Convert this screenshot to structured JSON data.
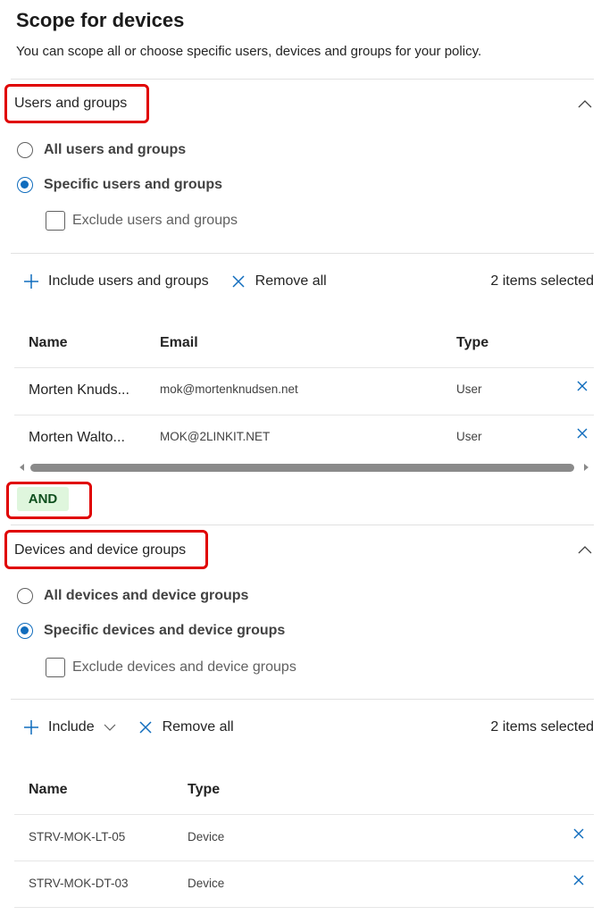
{
  "header": {
    "title": "Scope for devices",
    "subtitle": "You can scope all or choose specific users, devices and groups for your policy."
  },
  "users_section": {
    "title": "Users and groups",
    "option_all": "All users and groups",
    "option_specific": "Specific users and groups",
    "selected_option": "specific",
    "exclude_label": "Exclude users and groups",
    "toolbar": {
      "include_label": "Include users and groups",
      "remove_all_label": "Remove all",
      "count_label": "2 items selected"
    },
    "columns": [
      "Name",
      "Email",
      "Type"
    ],
    "rows": [
      {
        "name": "Morten Knuds...",
        "email": "mok@mortenknudsen.net",
        "type": "User"
      },
      {
        "name": "Morten Walto...",
        "email": "MOK@2LINKIT.NET",
        "type": "User"
      }
    ]
  },
  "operator": {
    "label": "AND"
  },
  "devices_section": {
    "title": "Devices and device groups",
    "option_all": "All devices and device groups",
    "option_specific": "Specific devices and device groups",
    "selected_option": "specific",
    "exclude_label": "Exclude devices and device groups",
    "toolbar": {
      "include_label": "Include",
      "remove_all_label": "Remove all",
      "count_label": "2 items selected"
    },
    "columns": [
      "Name",
      "Type"
    ],
    "rows": [
      {
        "name": "STRV-MOK-LT-05",
        "type": "Device"
      },
      {
        "name": "STRV-MOK-DT-03",
        "type": "Device"
      }
    ]
  },
  "colors": {
    "accent": "#0f6cbd",
    "highlight_box": "#e00000",
    "and_badge_bg": "#dff6dd"
  },
  "icons": [
    "chevron-up-icon",
    "add-icon",
    "close-icon",
    "chevron-down-icon",
    "remove-row-icon"
  ]
}
